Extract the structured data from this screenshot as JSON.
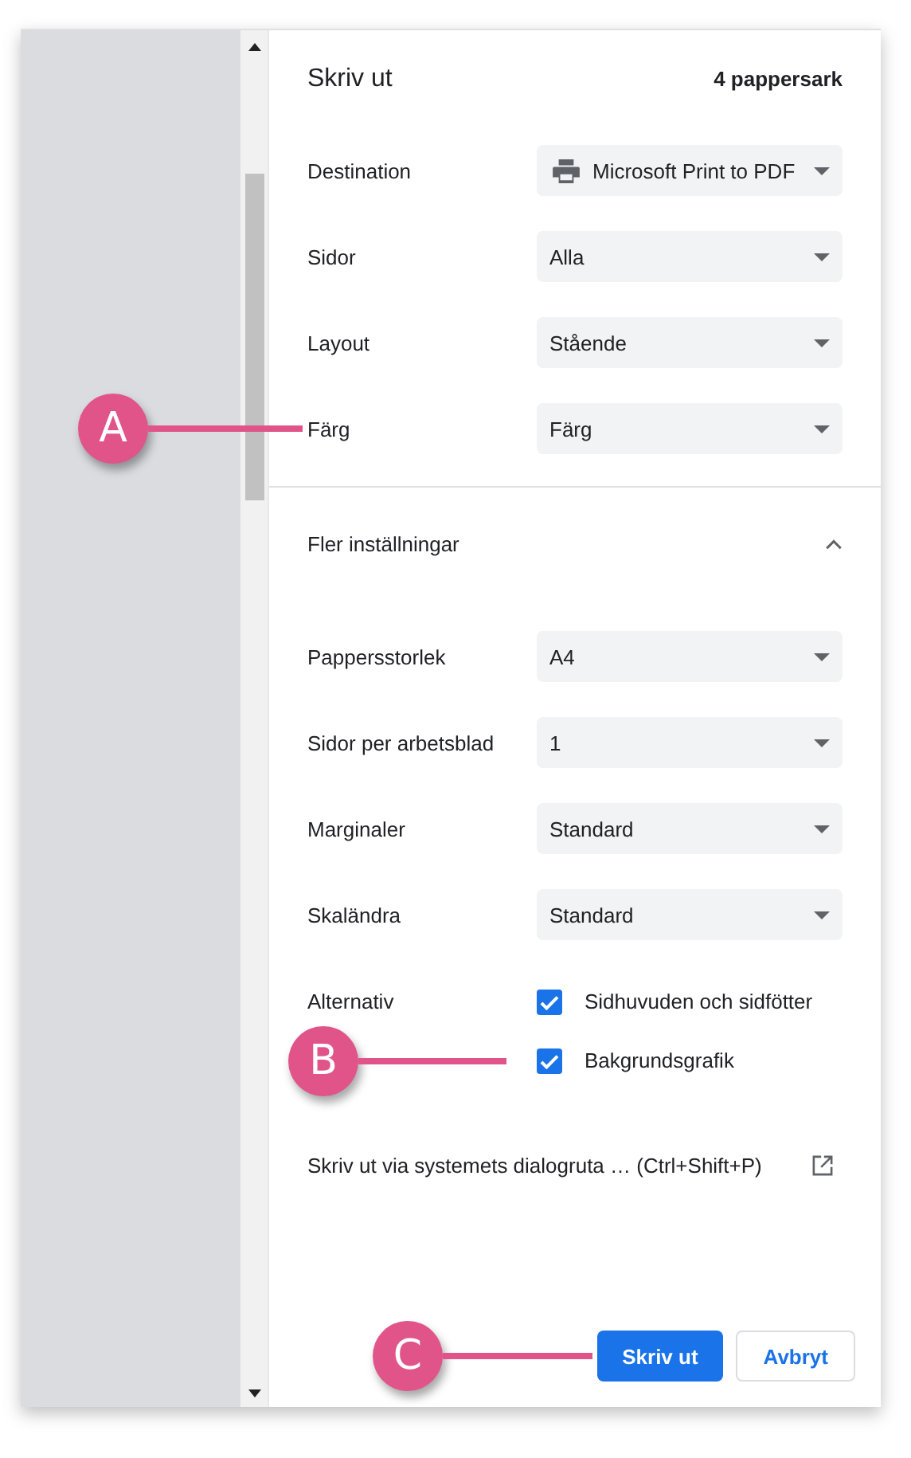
{
  "title": "Skriv ut",
  "sheet_count": "4 pappersark",
  "settings": [
    {
      "label": "Destination",
      "value": "Microsoft Print to PDF",
      "kind": "printer"
    },
    {
      "label": "Sidor",
      "value": "Alla",
      "kind": "plain"
    },
    {
      "label": "Layout",
      "value": "Stående",
      "kind": "plain"
    },
    {
      "label": "Färg",
      "value": "Färg",
      "kind": "plain",
      "callout": "A"
    }
  ],
  "more_settings": {
    "label": "Fler inställningar",
    "expanded": true
  },
  "advanced": [
    {
      "label": "Pappersstorlek",
      "value": "A4"
    },
    {
      "label": "Sidor per arbetsblad",
      "value": "1"
    },
    {
      "label": "Marginaler",
      "value": "Standard"
    },
    {
      "label": "Skaländra",
      "value": "Standard"
    }
  ],
  "options": {
    "label": "Alternativ",
    "checkboxes": [
      {
        "label": "Sidhuvuden och sidfötter",
        "checked": true
      },
      {
        "label": "Bakgrundsgrafik",
        "checked": true,
        "callout": "B"
      }
    ]
  },
  "system_dialog": "Skriv ut via systemets dialogruta … (Ctrl+Shift+P)",
  "buttons": [
    {
      "label": "Skriv ut",
      "kind": "primary",
      "callout": "C"
    },
    {
      "label": "Avbryt",
      "kind": "secondary"
    }
  ]
}
